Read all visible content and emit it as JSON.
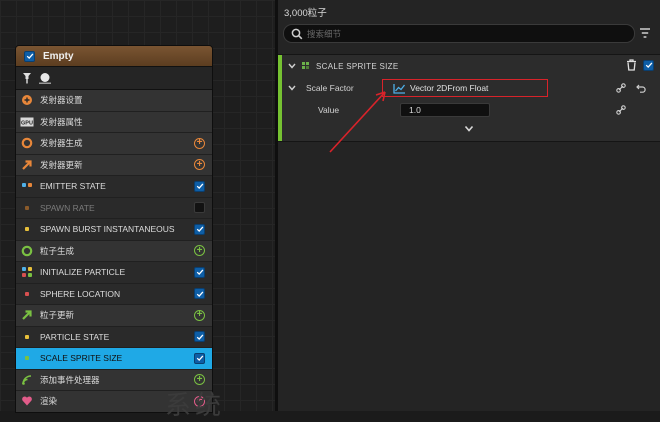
{
  "node": {
    "title": "Empty",
    "rows": [
      {
        "label": "发射器设置",
        "kind": "group",
        "icon": "emitter-settings-icon",
        "color": "#e8873a",
        "right": "none"
      },
      {
        "label": "发射器属性",
        "kind": "group",
        "icon": "emitter-properties-icon",
        "color": "#c8c8c8",
        "right": "none"
      },
      {
        "label": "发射器生成",
        "kind": "group",
        "icon": "emitter-spawn-icon",
        "color": "#e8873a",
        "right": "plus-orange"
      },
      {
        "label": "发射器更新",
        "kind": "group",
        "icon": "emitter-update-icon",
        "color": "#e8873a",
        "right": "plus-orange"
      },
      {
        "label": "EMITTER STATE",
        "kind": "item",
        "icon": "module-dots-icon",
        "color": "#e8873a",
        "right": "check"
      },
      {
        "label": "SPAWN RATE",
        "kind": "item-dim",
        "icon": "module-dot-icon",
        "color": "#8a5a2a",
        "right": "check-off"
      },
      {
        "label": "SPAWN BURST INSTANTANEOUS",
        "kind": "item",
        "icon": "module-dot-icon",
        "color": "#e8c03a",
        "right": "check"
      },
      {
        "label": "粒子生成",
        "kind": "group",
        "icon": "particle-spawn-icon",
        "color": "#7ac142",
        "right": "plus-green"
      },
      {
        "label": "INITIALIZE PARTICLE",
        "kind": "item",
        "icon": "module-multi-icon",
        "color": "#d85050",
        "right": "check"
      },
      {
        "label": "SPHERE LOCATION",
        "kind": "item",
        "icon": "module-dot-icon",
        "color": "#d85050",
        "right": "check"
      },
      {
        "label": "粒子更新",
        "kind": "group",
        "icon": "particle-update-icon",
        "color": "#7ac142",
        "right": "plus-green"
      },
      {
        "label": "PARTICLE STATE",
        "kind": "item",
        "icon": "module-dot-icon",
        "color": "#e8c03a",
        "right": "check"
      },
      {
        "label": "SCALE SPRITE SIZE",
        "kind": "selected",
        "icon": "module-dot-icon",
        "color": "#7ac142",
        "right": "check"
      },
      {
        "label": "添加事件处理器",
        "kind": "group",
        "icon": "event-handler-icon",
        "color": "#7ac142",
        "right": "plus-green"
      },
      {
        "label": "渲染",
        "kind": "group",
        "icon": "render-icon",
        "color": "#e25c8a",
        "right": "plus-pink"
      }
    ]
  },
  "panel": {
    "title": "3,000粒子",
    "search_placeholder": "搜索细节",
    "module_title": "SCALE SPRITE SIZE",
    "property_label": "Scale Factor",
    "dynamic_input": "Vector 2DFrom Float",
    "value_label": "Value",
    "value": "1.0"
  },
  "colors": {
    "accent_green": "#76c232",
    "selection_blue": "#1fa9e6",
    "highlight_red": "#d8232a"
  },
  "watermark": "系统"
}
